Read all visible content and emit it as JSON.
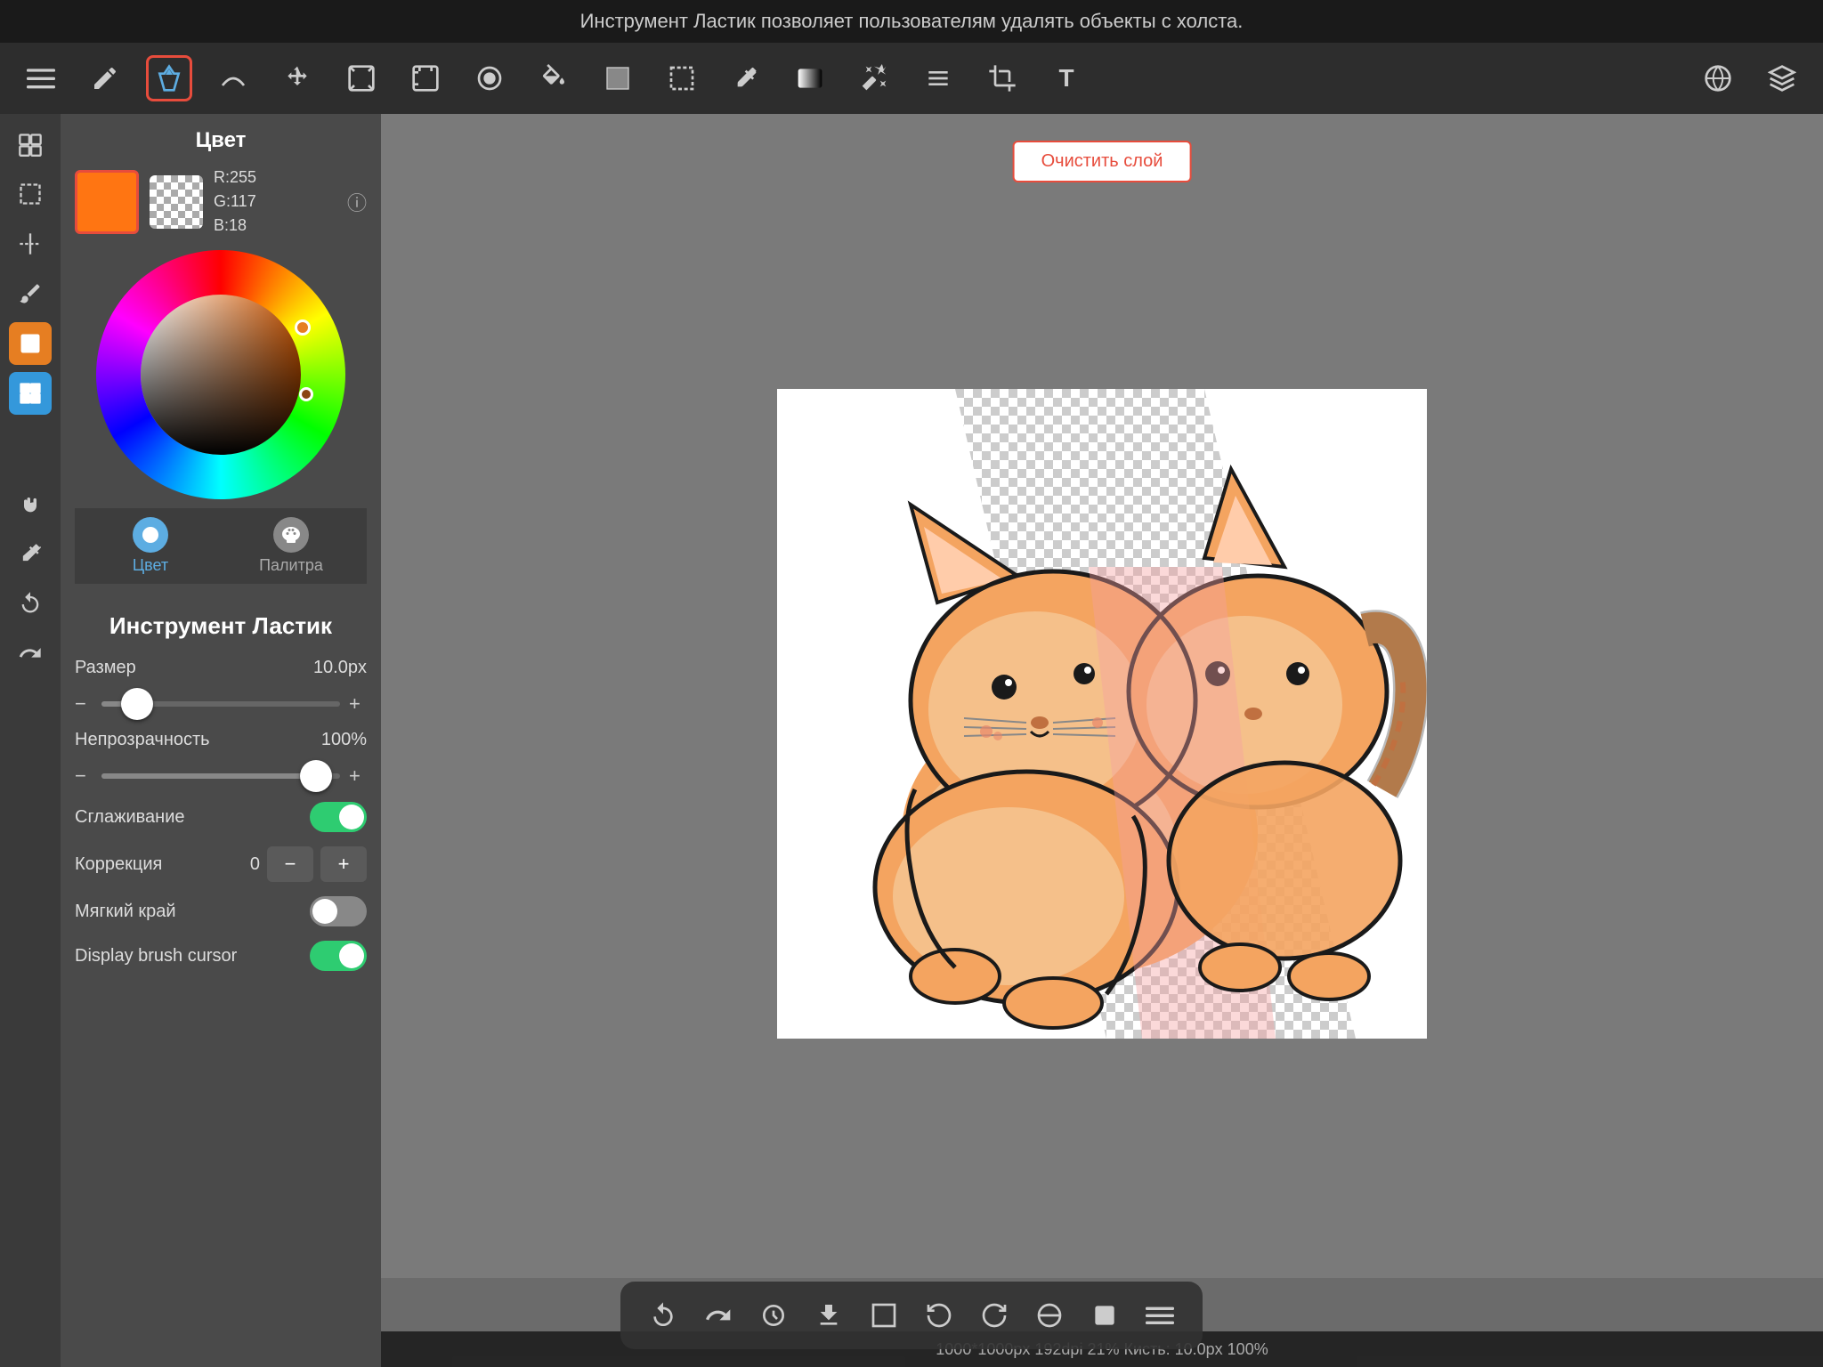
{
  "notification": {
    "text": "Инструмент Ластик позволяет пользователям удалять объекты с холста."
  },
  "top_toolbar": {
    "tools": [
      {
        "name": "menu",
        "symbol": "☰"
      },
      {
        "name": "pencil",
        "symbol": "✏"
      },
      {
        "name": "eraser-active",
        "symbol": "◆"
      },
      {
        "name": "smudge",
        "symbol": "∿"
      },
      {
        "name": "move",
        "symbol": "✛"
      },
      {
        "name": "transform",
        "symbol": "⬜"
      },
      {
        "name": "transform2",
        "symbol": "⬛"
      },
      {
        "name": "select-color",
        "symbol": "⬤"
      },
      {
        "name": "fill",
        "symbol": "▼"
      },
      {
        "name": "rect",
        "symbol": "□"
      },
      {
        "name": "dotted-rect",
        "symbol": "⬚"
      },
      {
        "name": "eyedropper",
        "symbol": "💉"
      },
      {
        "name": "gradient",
        "symbol": "⬛"
      },
      {
        "name": "magic-wand",
        "symbol": "◇"
      },
      {
        "name": "layers-grid",
        "symbol": "⊞"
      },
      {
        "name": "crop",
        "symbol": "⊡"
      },
      {
        "name": "text",
        "symbol": "T"
      },
      {
        "name": "spacer",
        "symbol": ""
      },
      {
        "name": "globe",
        "symbol": "🌐"
      },
      {
        "name": "layers",
        "symbol": "⧉"
      }
    ]
  },
  "left_sidebar": {
    "items": [
      {
        "name": "new-canvas",
        "symbol": "⊞"
      },
      {
        "name": "selection",
        "symbol": "⬚"
      },
      {
        "name": "guides",
        "symbol": "⊢"
      },
      {
        "name": "brush",
        "symbol": "🖌"
      },
      {
        "name": "color-swatch",
        "symbol": "◼",
        "active": "orange"
      },
      {
        "name": "layers-panel",
        "symbol": "⧉",
        "active": "blue"
      },
      {
        "name": "hand",
        "symbol": "✋"
      },
      {
        "name": "eyedropper2",
        "symbol": "💉"
      },
      {
        "name": "undo",
        "symbol": "↩"
      },
      {
        "name": "redo2",
        "symbol": "↪"
      }
    ]
  },
  "color_section": {
    "title": "Цвет",
    "primary_color": "#ff7512",
    "r": "R:255",
    "g": "G:117",
    "b": "B:18",
    "tabs": [
      {
        "id": "color",
        "label": "Цвет",
        "active": true
      },
      {
        "id": "palette",
        "label": "Палитра",
        "active": false
      }
    ]
  },
  "tool_settings": {
    "title": "Инструмент Ластик",
    "size_label": "Размер",
    "size_value": "10.0px",
    "size_percent": 15,
    "opacity_label": "Непрозрачность",
    "opacity_value": "100%",
    "opacity_percent": 90,
    "smoothing_label": "Сглаживание",
    "smoothing_on": true,
    "correction_label": "Коррекция",
    "correction_value": "0",
    "soft_edge_label": "Мягкий край",
    "soft_edge_on": false,
    "display_cursor_label": "Display brush cursor",
    "display_cursor_on": true
  },
  "canvas": {
    "clear_button": "Очистить слой",
    "status": "1000*1000px 192dpi 21% Кисть: 10.0px 100%"
  },
  "bottom_toolbar": {
    "icons": [
      {
        "name": "undo",
        "symbol": "↩"
      },
      {
        "name": "redo",
        "symbol": "↪"
      },
      {
        "name": "lasso",
        "symbol": "⊙"
      },
      {
        "name": "download",
        "symbol": "⬇"
      },
      {
        "name": "crop2",
        "symbol": "⬜"
      },
      {
        "name": "rotate-ccw",
        "symbol": "↺"
      },
      {
        "name": "rotate-cw",
        "symbol": "↻"
      },
      {
        "name": "flip",
        "symbol": "⊘"
      },
      {
        "name": "eraser-icon",
        "symbol": "◼"
      },
      {
        "name": "menu2",
        "symbol": "≡"
      }
    ]
  }
}
